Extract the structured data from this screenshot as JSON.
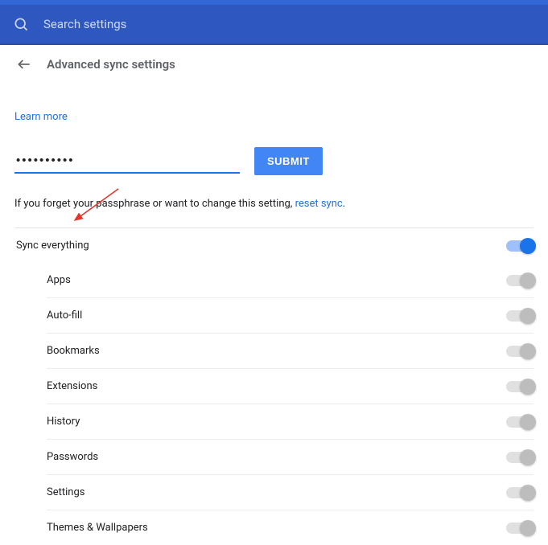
{
  "search": {
    "placeholder": "Search settings"
  },
  "breadcrumb": {
    "title": "Advanced sync settings"
  },
  "learn_more": "Learn more",
  "passphrase": {
    "masked_value": "••••••••••"
  },
  "submit_label": "SUBMIT",
  "helper": {
    "prefix": "If you forget your passphrase or want to change this setting, ",
    "link": "reset sync",
    "suffix": "."
  },
  "master": {
    "label": "Sync everything",
    "on": true
  },
  "sync_items": [
    {
      "label": "Apps"
    },
    {
      "label": "Auto-fill"
    },
    {
      "label": "Bookmarks"
    },
    {
      "label": "Extensions"
    },
    {
      "label": "History"
    },
    {
      "label": "Passwords"
    },
    {
      "label": "Settings"
    },
    {
      "label": "Themes & Wallpapers"
    }
  ]
}
